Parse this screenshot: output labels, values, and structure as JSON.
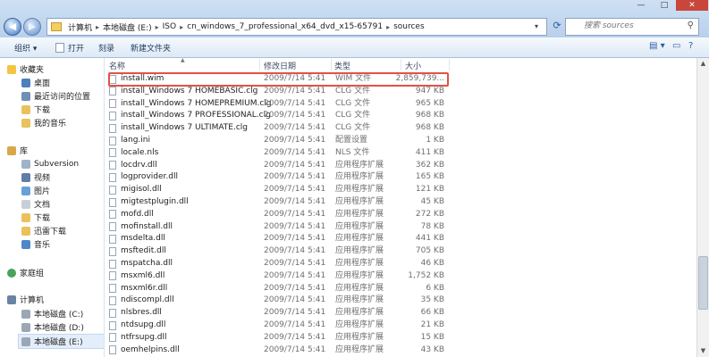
{
  "window": {
    "address": [
      "计算机",
      "本地磁盘 (E:)",
      "ISO",
      "cn_windows_7_professional_x64_dvd_x15-65791",
      "sources"
    ],
    "search_placeholder": "搜索 sources",
    "controls": {
      "minimize": "—",
      "maximize": "□",
      "close": "✕"
    }
  },
  "toolbar": {
    "organize": "组织 ▾",
    "open": "打开",
    "burn": "刻录",
    "new_folder": "新建文件夹"
  },
  "sidebar": {
    "favorites": "收藏夹",
    "favorites_items": [
      "桌面",
      "最近访问的位置",
      "下载",
      "我的音乐"
    ],
    "libraries": "库",
    "library_items": [
      "Subversion",
      "视频",
      "图片",
      "文档",
      "下载",
      "迅雷下载",
      "音乐"
    ],
    "homegroup": "家庭组",
    "computer": "计算机",
    "computer_items": [
      "本地磁盘 (C:)",
      "本地磁盘 (D:)",
      "本地磁盘 (E:)"
    ]
  },
  "columns": {
    "name": "名称",
    "date": "修改日期",
    "type": "类型",
    "size": "大小"
  },
  "files": [
    {
      "name": "install.wim",
      "date": "2009/7/14 5:41",
      "type": "WIM 文件",
      "size": "2,859,739..."
    },
    {
      "name": "install_Windows 7 HOMEBASIC.clg",
      "date": "2009/7/14 5:41",
      "type": "CLG 文件",
      "size": "947 KB"
    },
    {
      "name": "install_Windows 7 HOMEPREMIUM.clg",
      "date": "2009/7/14 5:41",
      "type": "CLG 文件",
      "size": "965 KB"
    },
    {
      "name": "install_Windows 7 PROFESSIONAL.clg",
      "date": "2009/7/14 5:41",
      "type": "CLG 文件",
      "size": "968 KB"
    },
    {
      "name": "install_Windows 7 ULTIMATE.clg",
      "date": "2009/7/14 5:41",
      "type": "CLG 文件",
      "size": "968 KB"
    },
    {
      "name": "lang.ini",
      "date": "2009/7/14 5:41",
      "type": "配置设置",
      "size": "1 KB"
    },
    {
      "name": "locale.nls",
      "date": "2009/7/14 5:41",
      "type": "NLS 文件",
      "size": "411 KB"
    },
    {
      "name": "locdrv.dll",
      "date": "2009/7/14 5:41",
      "type": "应用程序扩展",
      "size": "362 KB"
    },
    {
      "name": "logprovider.dll",
      "date": "2009/7/14 5:41",
      "type": "应用程序扩展",
      "size": "165 KB"
    },
    {
      "name": "migisol.dll",
      "date": "2009/7/14 5:41",
      "type": "应用程序扩展",
      "size": "121 KB"
    },
    {
      "name": "migtestplugin.dll",
      "date": "2009/7/14 5:41",
      "type": "应用程序扩展",
      "size": "45 KB"
    },
    {
      "name": "mofd.dll",
      "date": "2009/7/14 5:41",
      "type": "应用程序扩展",
      "size": "272 KB"
    },
    {
      "name": "mofinstall.dll",
      "date": "2009/7/14 5:41",
      "type": "应用程序扩展",
      "size": "78 KB"
    },
    {
      "name": "msdelta.dll",
      "date": "2009/7/14 5:41",
      "type": "应用程序扩展",
      "size": "441 KB"
    },
    {
      "name": "msftedit.dll",
      "date": "2009/7/14 5:41",
      "type": "应用程序扩展",
      "size": "705 KB"
    },
    {
      "name": "mspatcha.dll",
      "date": "2009/7/14 5:41",
      "type": "应用程序扩展",
      "size": "46 KB"
    },
    {
      "name": "msxml6.dll",
      "date": "2009/7/14 5:41",
      "type": "应用程序扩展",
      "size": "1,752 KB"
    },
    {
      "name": "msxml6r.dll",
      "date": "2009/7/14 5:41",
      "type": "应用程序扩展",
      "size": "6 KB"
    },
    {
      "name": "ndiscompl.dll",
      "date": "2009/7/14 5:41",
      "type": "应用程序扩展",
      "size": "35 KB"
    },
    {
      "name": "nlsbres.dll",
      "date": "2009/7/14 5:41",
      "type": "应用程序扩展",
      "size": "66 KB"
    },
    {
      "name": "ntdsupg.dll",
      "date": "2009/7/14 5:41",
      "type": "应用程序扩展",
      "size": "21 KB"
    },
    {
      "name": "ntfrsupg.dll",
      "date": "2009/7/14 5:41",
      "type": "应用程序扩展",
      "size": "15 KB"
    },
    {
      "name": "oemhelpins.dll",
      "date": "2009/7/14 5:41",
      "type": "应用程序扩展",
      "size": "43 KB"
    }
  ],
  "colors": {
    "highlight_box": "#e05248",
    "selection": "#e4eefa"
  }
}
